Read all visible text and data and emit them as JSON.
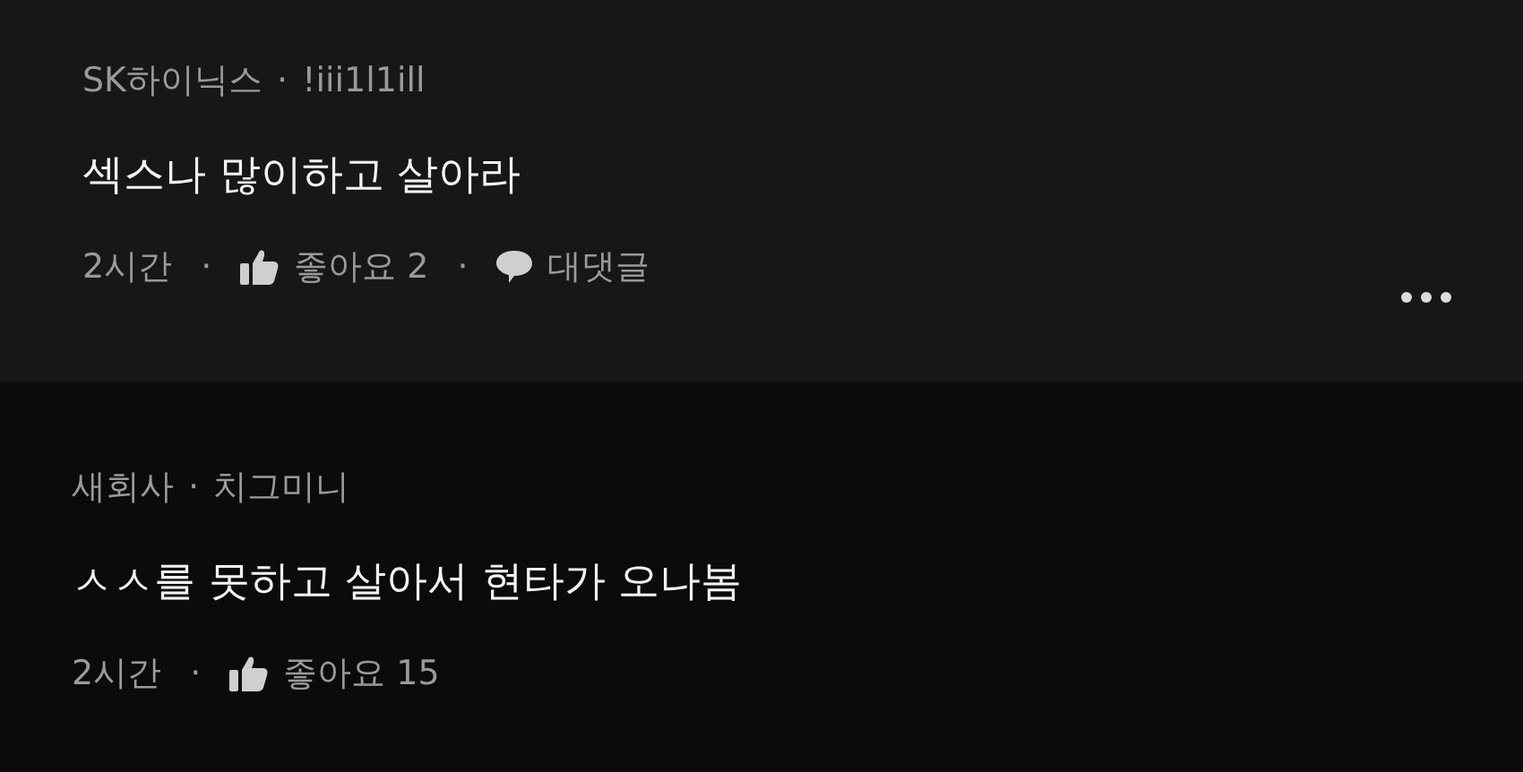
{
  "comments": [
    {
      "author": {
        "company": "SK하이닉스",
        "separator": "·",
        "nickname": "!iii1l1ill"
      },
      "body": "섹스나 많이하고 살아라",
      "meta": [
        {
          "kind": "time",
          "text": "2시간"
        },
        {
          "kind": "dot",
          "text": "·"
        },
        {
          "kind": "like",
          "text": "좋아요 2"
        },
        {
          "kind": "dot",
          "text": "·"
        },
        {
          "kind": "reply",
          "text": "대댓글"
        }
      ],
      "more_menu": true,
      "replies": [
        {
          "author": {
            "company": "새회사",
            "separator": "·",
            "nickname": "치그미니"
          },
          "body": "ㅅㅅ를 못하고 살아서 현타가 오나봄",
          "meta": [
            {
              "kind": "time",
              "text": "2시간"
            },
            {
              "kind": "dot",
              "text": "·"
            },
            {
              "kind": "like",
              "text": "좋아요 15"
            }
          ]
        }
      ]
    }
  ]
}
